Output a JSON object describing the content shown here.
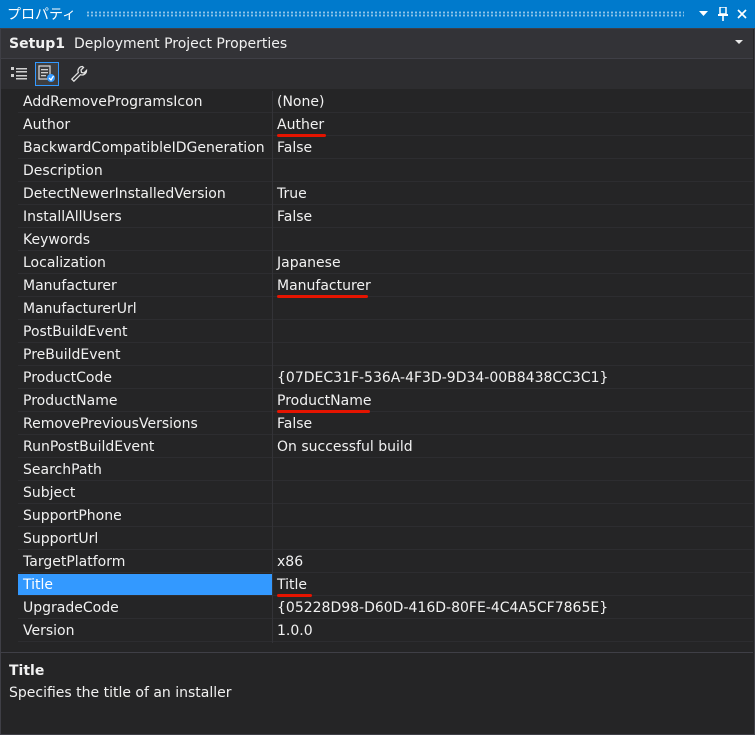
{
  "window": {
    "title": "プロパティ",
    "dropdown_icon": "chevron-down-icon",
    "pin_icon": "pin-icon",
    "close_icon": "close-icon"
  },
  "object_selector": {
    "object": "Setup1",
    "type": "Deployment Project Properties"
  },
  "toolbar": {
    "buttons": [
      {
        "icon": "categorized-icon"
      },
      {
        "icon": "property-pages-icon",
        "active": true
      },
      {
        "icon": "wrench-icon"
      }
    ]
  },
  "properties": [
    {
      "name": "AddRemoveProgramsIcon",
      "value": "(None)"
    },
    {
      "name": "Author",
      "value": "Auther"
    },
    {
      "name": "BackwardCompatibleIDGeneration",
      "value": "False"
    },
    {
      "name": "Description",
      "value": ""
    },
    {
      "name": "DetectNewerInstalledVersion",
      "value": "True"
    },
    {
      "name": "InstallAllUsers",
      "value": "False"
    },
    {
      "name": "Keywords",
      "value": ""
    },
    {
      "name": "Localization",
      "value": "Japanese"
    },
    {
      "name": "Manufacturer",
      "value": "Manufacturer"
    },
    {
      "name": "ManufacturerUrl",
      "value": ""
    },
    {
      "name": "PostBuildEvent",
      "value": ""
    },
    {
      "name": "PreBuildEvent",
      "value": ""
    },
    {
      "name": "ProductCode",
      "value": "{07DEC31F-536A-4F3D-9D34-00B8438CC3C1}"
    },
    {
      "name": "ProductName",
      "value": "ProductName"
    },
    {
      "name": "RemovePreviousVersions",
      "value": "False"
    },
    {
      "name": "RunPostBuildEvent",
      "value": "On successful build"
    },
    {
      "name": "SearchPath",
      "value": ""
    },
    {
      "name": "Subject",
      "value": ""
    },
    {
      "name": "SupportPhone",
      "value": ""
    },
    {
      "name": "SupportUrl",
      "value": ""
    },
    {
      "name": "TargetPlatform",
      "value": "x86"
    },
    {
      "name": "Title",
      "value": "Title",
      "selected": true
    },
    {
      "name": "UpgradeCode",
      "value": "{05228D98-D60D-416D-80FE-4C4A5CF7865E}"
    },
    {
      "name": "Version",
      "value": "1.0.0"
    }
  ],
  "description": {
    "title": "Title",
    "text": "Specifies the title of an installer"
  },
  "colors": {
    "accent": "#007acc",
    "selection": "#3399ff",
    "annotation_underline": "#e51400"
  }
}
